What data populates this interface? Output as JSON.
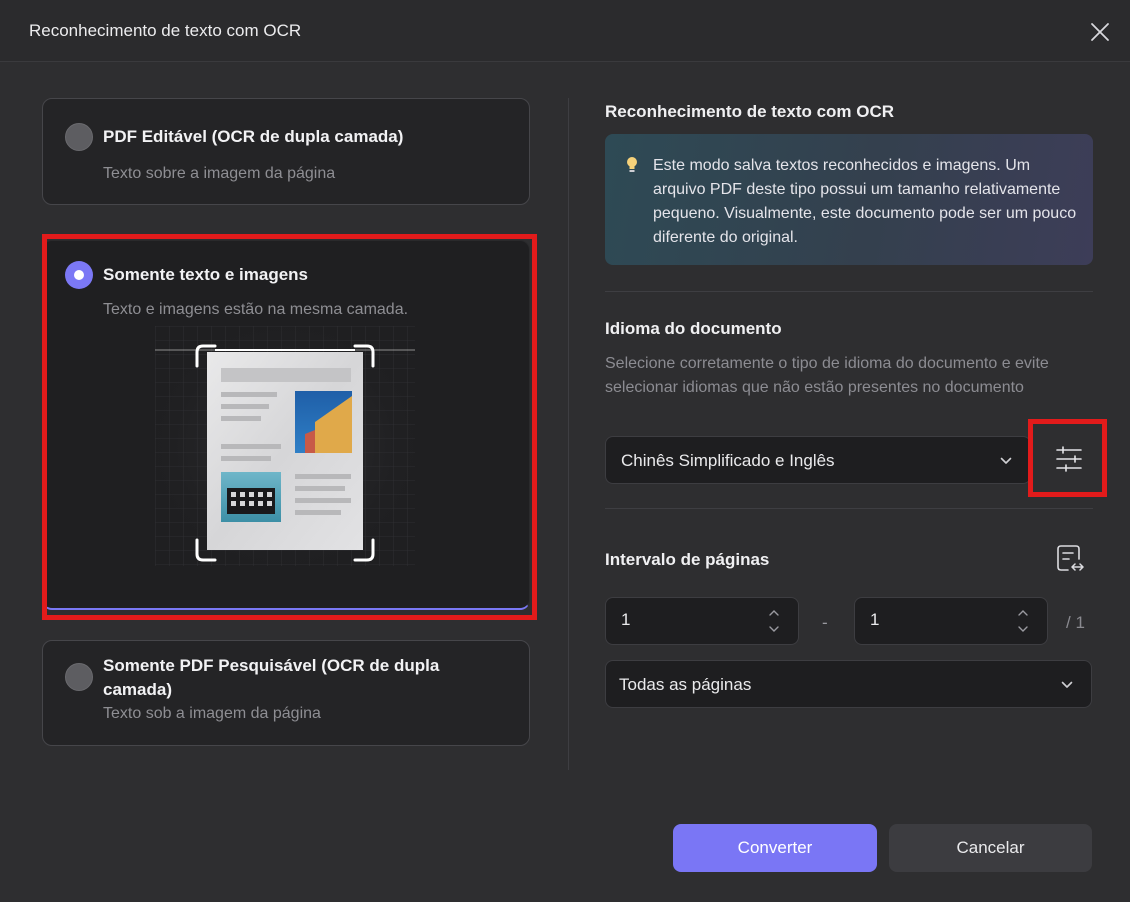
{
  "window": {
    "title": "Reconhecimento de texto com OCR",
    "close_icon": "close-icon"
  },
  "options": [
    {
      "title": "PDF Editável (OCR de dupla camada)",
      "subtitle": "Texto sobre a imagem da página",
      "selected": false
    },
    {
      "title": "Somente texto e imagens",
      "subtitle": "Texto e imagens estão na mesma camada.",
      "selected": true
    },
    {
      "title_line1": "Somente PDF Pesquisável (OCR de dupla",
      "title_line2": "camada)",
      "subtitle": "Texto sob a imagem da página",
      "selected": false
    }
  ],
  "right": {
    "heading": "Reconhecimento de texto com OCR",
    "info_icon": "lightbulb-icon",
    "info_text": "Este modo salva textos reconhecidos e imagens. Um arquivo PDF deste tipo possui um tamanho relativamente pequeno. Visualmente, este documento pode ser um pouco diferente do original.",
    "language": {
      "heading": "Idioma do documento",
      "help": "Selecione corretamente o tipo de idioma do documento e evite selecionar idiomas que não estão presentes no documento",
      "selected": "Chinês Simplificado e Inglês",
      "settings_icon": "sliders-icon"
    },
    "range": {
      "heading": "Intervalo de páginas",
      "range_icon": "page-range-icon",
      "from": "1",
      "separator": "-",
      "to": "1",
      "total": "/ 1",
      "pages_option": "Todas as páginas"
    }
  },
  "buttons": {
    "convert": "Converter",
    "cancel": "Cancelar"
  },
  "colors": {
    "accent": "#7a76f5",
    "highlight": "#e21b1b"
  }
}
